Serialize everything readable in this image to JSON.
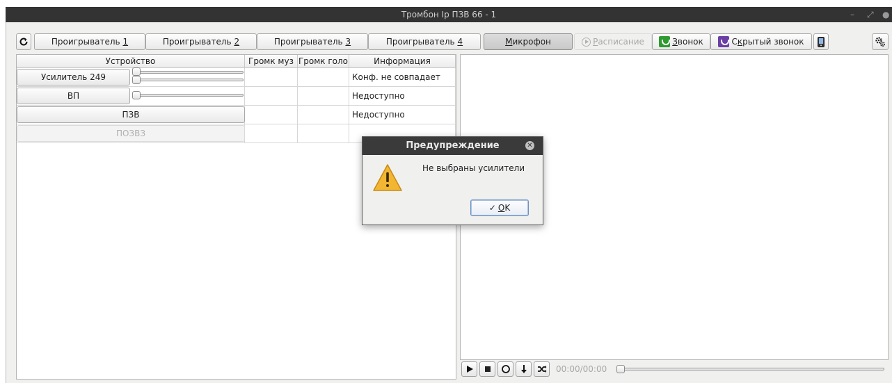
{
  "window": {
    "title": "Тромбон Ip ПЗВ 66 - 1"
  },
  "toolbar": {
    "refresh_icon": "refresh-icon",
    "tabs": [
      {
        "label_pre": "Проигрыватель ",
        "label_u": "1"
      },
      {
        "label_pre": "Проигрыватель ",
        "label_u": "2"
      },
      {
        "label_pre": "Проигрыватель ",
        "label_u": "3"
      },
      {
        "label_pre": "Проигрыватель ",
        "label_u": "4"
      }
    ],
    "mic": {
      "label_u": "М",
      "label_rest": "икрофон"
    },
    "schedule": {
      "label_u": "Р",
      "label_rest": "асписание"
    },
    "call": {
      "label_u": "З",
      "label_rest": "вонок"
    },
    "hidden_call": {
      "label_pre": "С",
      "label_u": "к",
      "label_rest": "рытый звонок"
    },
    "settings_icon": "gears-icon",
    "device_icon": "mobile-device-icon"
  },
  "table": {
    "headers": [
      "Устройство",
      "Громк муз",
      "Громк голо",
      "Информация"
    ],
    "rows": [
      {
        "device": "Усилитель 249",
        "info": "Конф. не совпадает",
        "has_sliders": 2,
        "enabled": true
      },
      {
        "device": "ВП",
        "info": "Недоступно",
        "has_sliders": 1,
        "enabled": true
      },
      {
        "device": "ПЗВ",
        "info": "Недоступно",
        "has_sliders": 0,
        "enabled": true
      },
      {
        "device": "ПОЗВЗ",
        "info": "",
        "has_sliders": 0,
        "enabled": false
      }
    ]
  },
  "player": {
    "time": "00:00/00:00"
  },
  "dialog": {
    "title": "Предупреждение",
    "message": "Не выбраны усилители",
    "ok_u": "O",
    "ok_rest": "K"
  },
  "colors": {
    "titlebar": "#333333",
    "call_icon": "#2f9a2f",
    "hidden_call_icon": "#6b3fa4",
    "warning": "#f2b632"
  }
}
